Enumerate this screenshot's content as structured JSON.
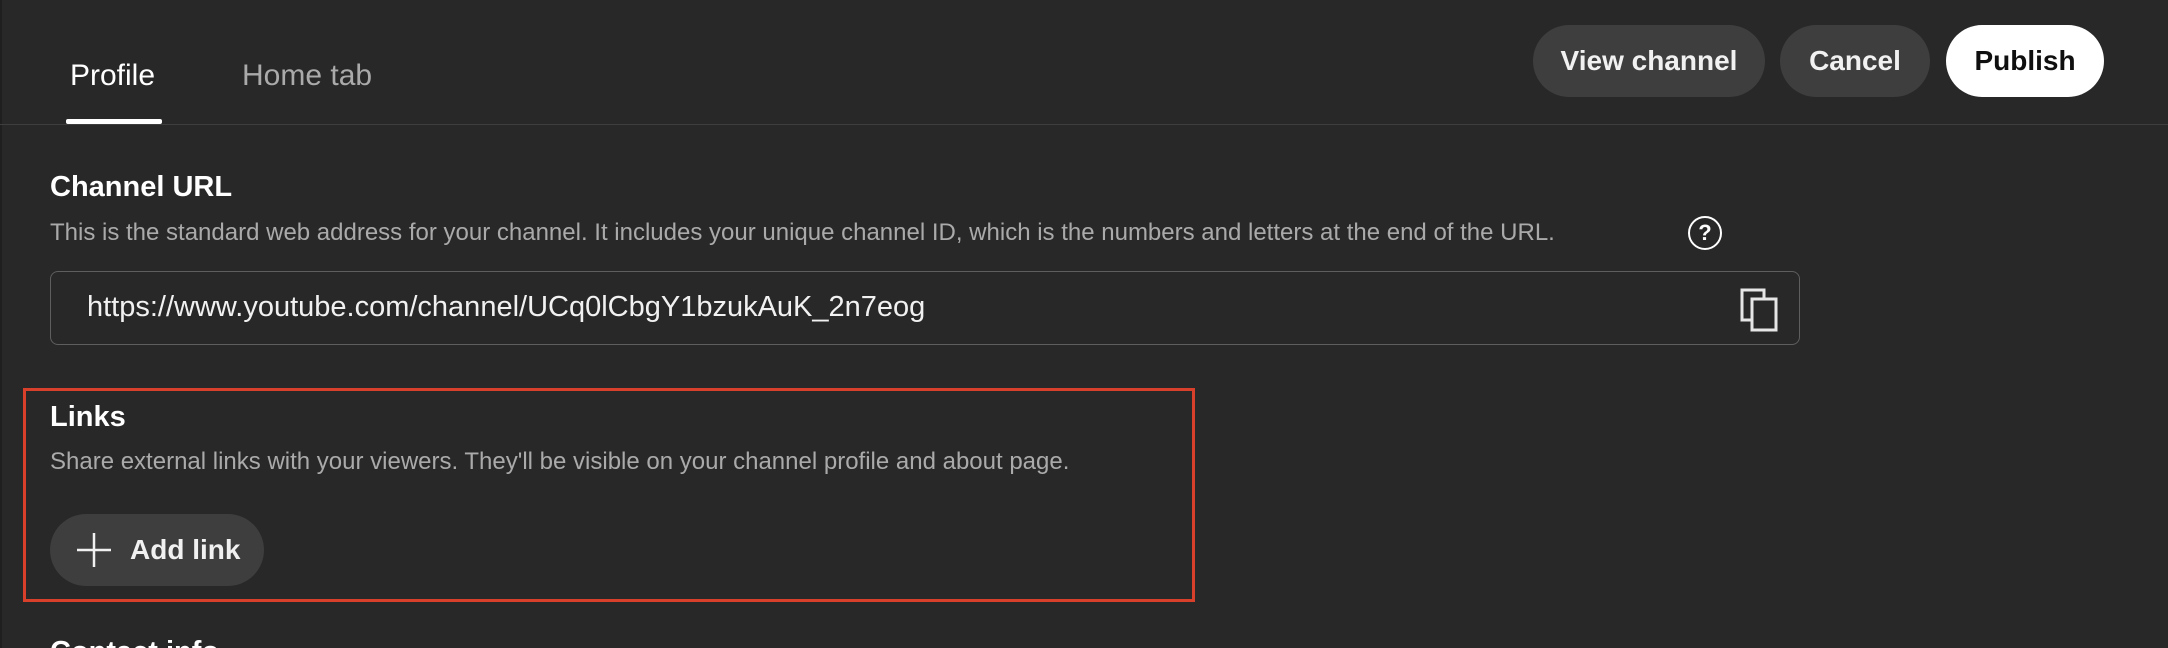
{
  "tabs": [
    {
      "label": "Profile",
      "active": true
    },
    {
      "label": "Home tab",
      "active": false
    }
  ],
  "header": {
    "view_channel_label": "View channel",
    "cancel_label": "Cancel",
    "publish_label": "Publish"
  },
  "channel_url": {
    "title": "Channel URL",
    "description": "This is the standard web address for your channel. It includes your unique channel ID, which is the numbers and letters at the end of the URL.",
    "help_icon": "help-circle-icon",
    "value": "https://www.youtube.com/channel/UCq0lCbgY1bzukAuK_2n7eog",
    "copy_icon": "copy-icon"
  },
  "links": {
    "title": "Links",
    "description": "Share external links with your viewers. They'll be visible on your channel profile and about page.",
    "add_link_label": "Add link",
    "add_icon": "plus-icon",
    "highlight_color": "#d9402b"
  },
  "next_section": {
    "title": "Contact info"
  },
  "colors": {
    "background": "#282828",
    "button_bg": "#3e3e3e",
    "publish_bg": "#ffffff",
    "secondary_text": "#aaaaaa"
  }
}
